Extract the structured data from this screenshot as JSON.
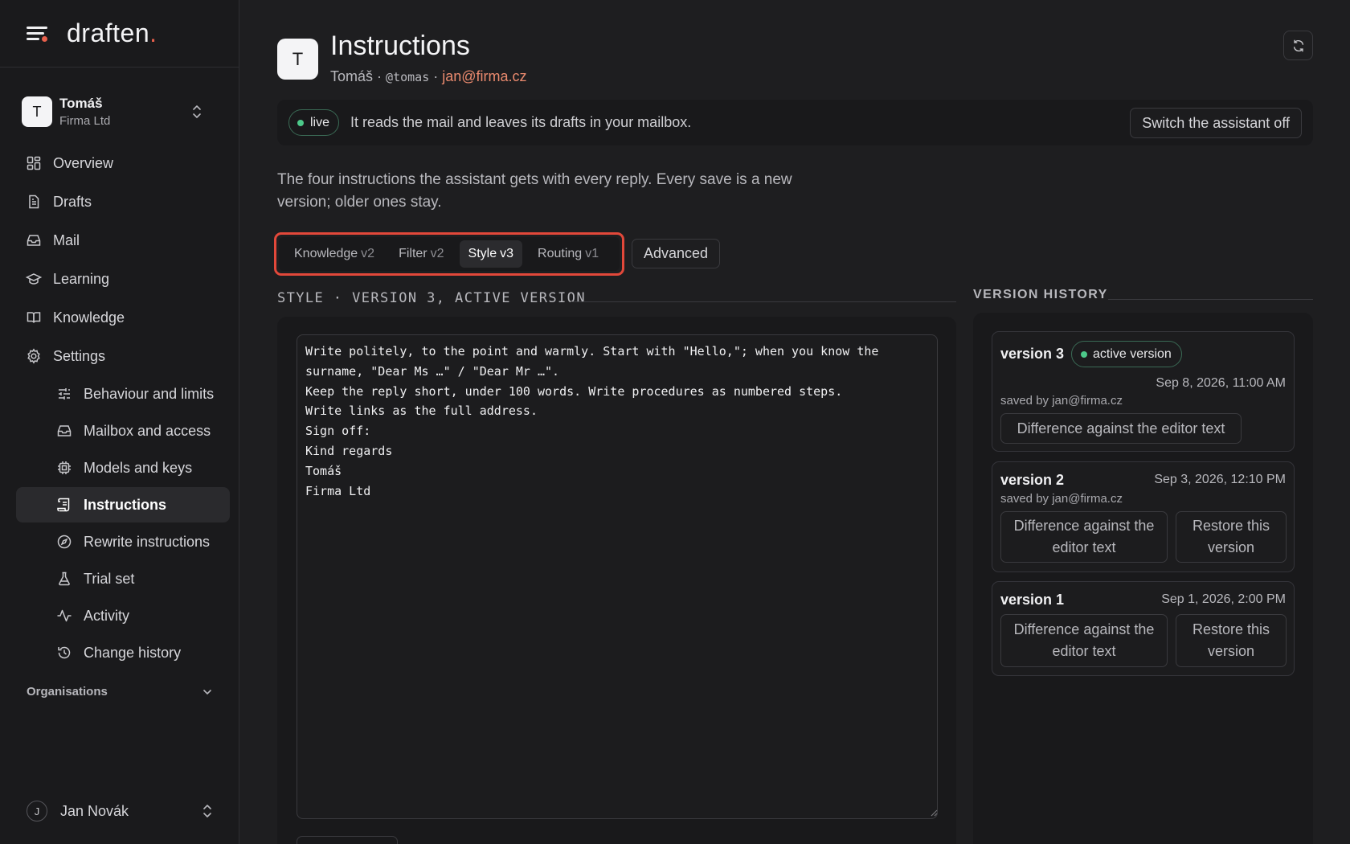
{
  "app": {
    "name": "draften",
    "name_dot": "."
  },
  "account": {
    "avatar": "T",
    "name": "Tomáš",
    "org": "Firma Ltd"
  },
  "nav": {
    "overview": "Overview",
    "drafts": "Drafts",
    "mail": "Mail",
    "learning": "Learning",
    "knowledge": "Knowledge",
    "settings": "Settings",
    "sub": {
      "behaviour": "Behaviour and limits",
      "mailbox": "Mailbox and access",
      "models": "Models and keys",
      "instructions": "Instructions",
      "rewrite": "Rewrite instructions",
      "trial": "Trial set",
      "activity": "Activity",
      "history": "Change history"
    },
    "organisations": "Organisations"
  },
  "user": {
    "initial": "J",
    "name": "Jan Novák"
  },
  "page": {
    "avatar": "T",
    "title": "Instructions",
    "owner": "Tomáš",
    "sep": "·",
    "handle": "@tomas",
    "email": "jan@firma.cz"
  },
  "status": {
    "pill": "live",
    "text": "It reads the mail and leaves its drafts in your mailbox.",
    "switch_label": "Switch the assistant off"
  },
  "description": "The four instructions the assistant gets with every reply. Every save is a new version; older ones stay.",
  "tabs": [
    {
      "label": "Knowledge",
      "version": "v2"
    },
    {
      "label": "Filter",
      "version": "v2"
    },
    {
      "label": "Style",
      "version": "v3"
    },
    {
      "label": "Routing",
      "version": "v1"
    }
  ],
  "advanced_label": "Advanced",
  "editor": {
    "section_label": "STYLE · VERSION 3, ACTIVE VERSION",
    "text": "Write politely, to the point and warmly. Start with \"Hello,\"; when you know the\nsurname, \"Dear Ms …\" / \"Dear Mr …\".\nKeep the reply short, under 100 words. Write procedures as numbered steps.\nWrite links as the full address.\nSign off:\nKind regards\nTomáš\nFirma Ltd"
  },
  "history": {
    "label": "VERSION HISTORY",
    "versions": [
      {
        "name": "version 3",
        "badge": "active version",
        "date": "Sep 8, 2026, 11:00 AM",
        "saved_by": "saved by jan@firma.cz",
        "diff": "Difference against the editor text"
      },
      {
        "name": "version 2",
        "date": "Sep 3, 2026, 12:10 PM",
        "saved_by": "saved by jan@firma.cz",
        "diff": "Difference against the editor text",
        "restore": "Restore this version"
      },
      {
        "name": "version 1",
        "date": "Sep 1, 2026, 2:00 PM",
        "diff": "Difference against the editor text",
        "restore": "Restore this version"
      }
    ]
  },
  "colors": {
    "accent": "#e8604c",
    "live": "#4cc98a",
    "email": "#ea8a6e",
    "highlight": "#e2483a"
  }
}
